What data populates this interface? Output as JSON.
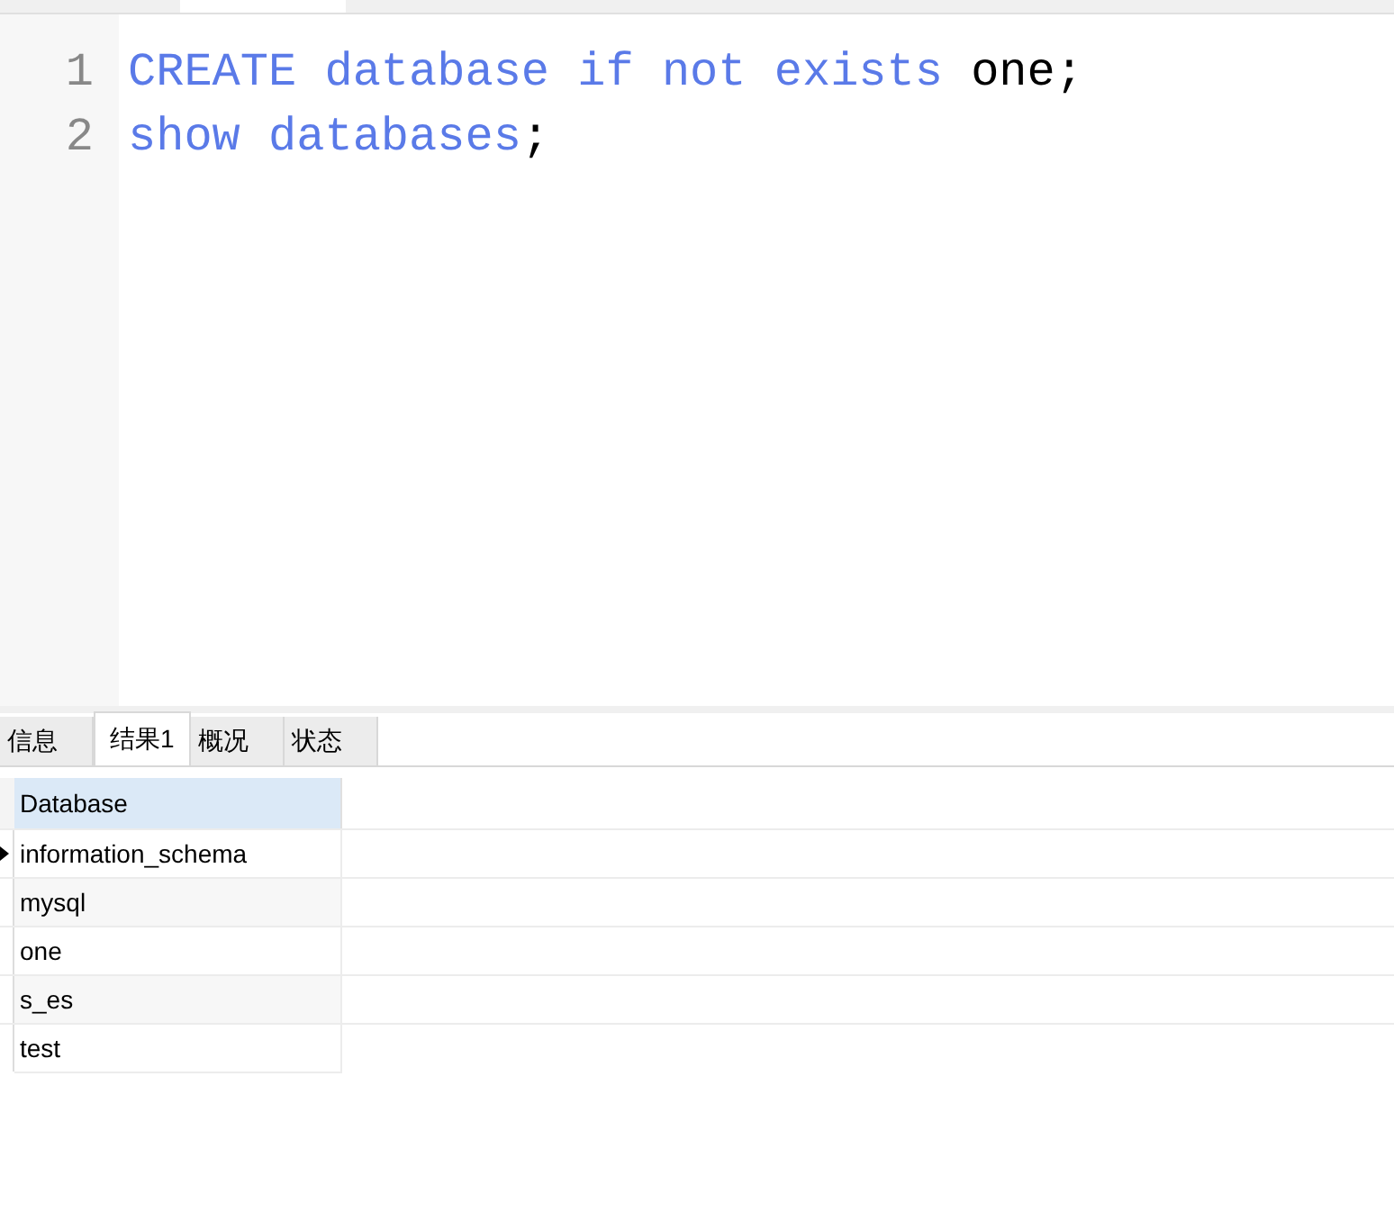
{
  "editor": {
    "lines": [
      {
        "number": "1",
        "tokens": [
          {
            "kind": "keyword",
            "text": "CREATE database if not exists "
          },
          {
            "kind": "plain",
            "text": "one;"
          }
        ]
      },
      {
        "number": "2",
        "tokens": [
          {
            "kind": "keyword",
            "text": "show databases"
          },
          {
            "kind": "plain",
            "text": ";"
          }
        ]
      }
    ]
  },
  "result_tabs": [
    {
      "label": "信息",
      "selected": false
    },
    {
      "label": "结果1",
      "selected": true
    },
    {
      "label": "概况",
      "selected": false
    },
    {
      "label": "状态",
      "selected": false
    }
  ],
  "table": {
    "columns": [
      "Database"
    ],
    "rows": [
      {
        "cells": [
          "information_schema"
        ],
        "current": true
      },
      {
        "cells": [
          "mysql"
        ],
        "current": false
      },
      {
        "cells": [
          "one"
        ],
        "current": false
      },
      {
        "cells": [
          "s_es"
        ],
        "current": false
      },
      {
        "cells": [
          "test"
        ],
        "current": false
      }
    ]
  }
}
